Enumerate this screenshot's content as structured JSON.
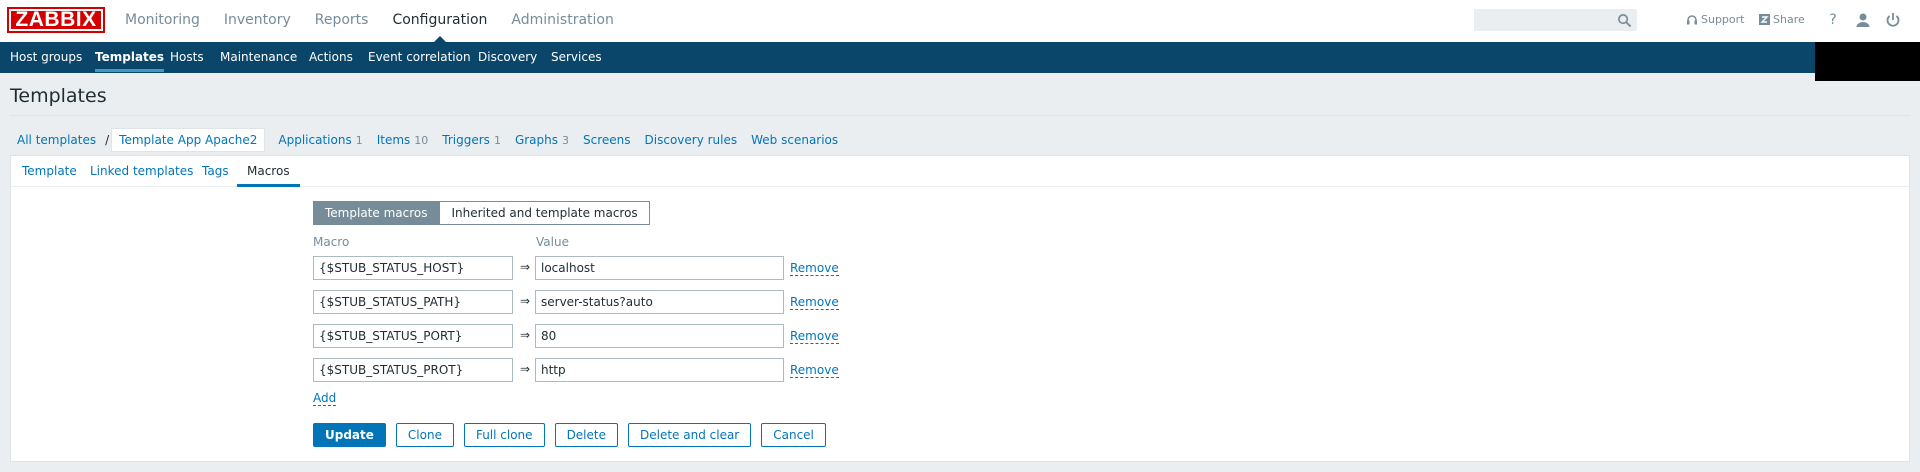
{
  "logo": "ZABBIX",
  "top_menu": [
    {
      "label": "Monitoring",
      "active": false
    },
    {
      "label": "Inventory",
      "active": false
    },
    {
      "label": "Reports",
      "active": false
    },
    {
      "label": "Configuration",
      "active": true
    },
    {
      "label": "Administration",
      "active": false
    }
  ],
  "header_links": {
    "support": "Support",
    "share": "Share",
    "help": "?"
  },
  "nav": [
    {
      "label": "Host groups",
      "active": false
    },
    {
      "label": "Templates",
      "active": true
    },
    {
      "label": "Hosts",
      "active": false
    },
    {
      "label": "Maintenance",
      "active": false
    },
    {
      "label": "Actions",
      "active": false
    },
    {
      "label": "Event correlation",
      "active": false
    },
    {
      "label": "Discovery",
      "active": false
    },
    {
      "label": "Services",
      "active": false
    }
  ],
  "page_title": "Templates",
  "breadcrumb": {
    "all": "All templates",
    "separator": "/",
    "current": "Template App Apache2",
    "links": [
      {
        "label": "Applications",
        "count": "1"
      },
      {
        "label": "Items",
        "count": "10"
      },
      {
        "label": "Triggers",
        "count": "1"
      },
      {
        "label": "Graphs",
        "count": "3"
      },
      {
        "label": "Screens",
        "count": ""
      },
      {
        "label": "Discovery rules",
        "count": ""
      },
      {
        "label": "Web scenarios",
        "count": ""
      }
    ]
  },
  "tabs": [
    {
      "label": "Template",
      "active": false
    },
    {
      "label": "Linked templates",
      "active": false
    },
    {
      "label": "Tags",
      "active": false
    },
    {
      "label": "Macros",
      "active": true
    }
  ],
  "macro_mode": {
    "selected": "Template macros",
    "other": "Inherited and template macros"
  },
  "columns": {
    "macro": "Macro",
    "value": "Value"
  },
  "macros": [
    {
      "macro": "{$STUB_STATUS_HOST}",
      "arrow": "⇒",
      "value": "localhost",
      "remove": "Remove"
    },
    {
      "macro": "{$STUB_STATUS_PATH}",
      "arrow": "⇒",
      "value": "server-status?auto",
      "remove": "Remove"
    },
    {
      "macro": "{$STUB_STATUS_PORT}",
      "arrow": "⇒",
      "value": "80",
      "remove": "Remove"
    },
    {
      "macro": "{$STUB_STATUS_PROT}",
      "arrow": "⇒",
      "value": "http",
      "remove": "Remove"
    }
  ],
  "add_label": "Add",
  "buttons": {
    "update": "Update",
    "clone": "Clone",
    "full_clone": "Full clone",
    "delete": "Delete",
    "delete_clear": "Delete and clear",
    "cancel": "Cancel"
  },
  "colors": {
    "brand": "#d40000",
    "navbar": "#0a466a",
    "link": "#0275b8",
    "accent": "#4796c4"
  }
}
